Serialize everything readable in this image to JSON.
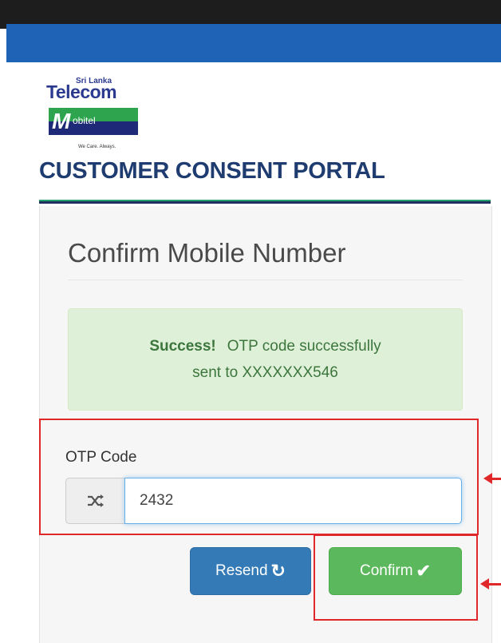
{
  "logo": {
    "sri_lanka": "Sri Lanka",
    "telecom": "Telecom",
    "mobitel_m": "M",
    "mobitel_rest": "obitel",
    "tagline": "We Care. Always."
  },
  "header": {
    "portal_title": "CUSTOMER CONSENT PORTAL"
  },
  "card": {
    "title": "Confirm Mobile Number",
    "alert": {
      "strong": "Success!",
      "message": "OTP code successfully",
      "message_line2": "sent to XXXXXXX546"
    },
    "otp": {
      "label": "OTP Code",
      "addon_icon": "shuffle-icon",
      "value": "2432"
    },
    "buttons": {
      "resend_label": "Resend",
      "resend_icon": "refresh-icon",
      "confirm_label": "Confirm",
      "confirm_icon": "checkmark-icon"
    }
  },
  "colors": {
    "navbar": "#1f63b6",
    "title": "#1e3c6f",
    "alert_bg": "#dff0d8",
    "alert_text": "#3c763d",
    "resend_btn": "#337ab7",
    "confirm_btn": "#5cb85c",
    "annotation": "#e0272a"
  }
}
